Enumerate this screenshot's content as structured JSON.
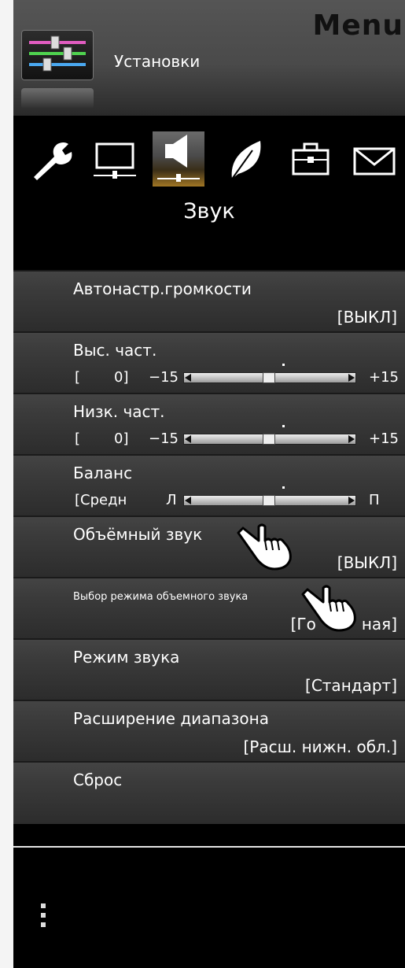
{
  "header": {
    "title": "Menu",
    "section_label": "Установки",
    "section_icon": "sliders-icon"
  },
  "tabs": {
    "items": [
      {
        "icon": "wrench-icon"
      },
      {
        "icon": "monitor-icon"
      },
      {
        "icon": "speaker-icon",
        "active": true
      },
      {
        "icon": "leaf-icon"
      },
      {
        "icon": "toolbox-icon"
      },
      {
        "icon": "envelope-icon"
      }
    ],
    "active_label": "Звук"
  },
  "rows": {
    "auto_volume": {
      "label": "Автонастр.громкости",
      "value": "[ВЫКЛ]"
    },
    "treble": {
      "label": "Выс. част.",
      "bracket": "[",
      "value": "0]",
      "min": "−15",
      "max": "+15",
      "level": 0
    },
    "bass": {
      "label": "Низк. част.",
      "bracket": "[",
      "value": "0]",
      "min": "−15",
      "max": "+15",
      "level": 0
    },
    "balance": {
      "label": "Баланс",
      "value": "[Средн",
      "min": "Л",
      "max": "П",
      "level": 0
    },
    "surround": {
      "label": "Объёмный звук",
      "value": "[ВЫКЛ]"
    },
    "surround_mode": {
      "label": "Выбор режима объемного звука",
      "value": "[Го",
      "value_end": "ная]"
    },
    "sound_mode": {
      "label": "Режим звука",
      "value": "[Стандарт]"
    },
    "range_ext": {
      "label": "Расширение диапазона",
      "value": "[Расш. нижн. обл.]"
    },
    "reset": {
      "label": "Сброс"
    }
  },
  "colors": {
    "background": "#000000",
    "header": "#4a4a4a",
    "active_tab": "#a07624",
    "row": "#3b3b3b"
  }
}
